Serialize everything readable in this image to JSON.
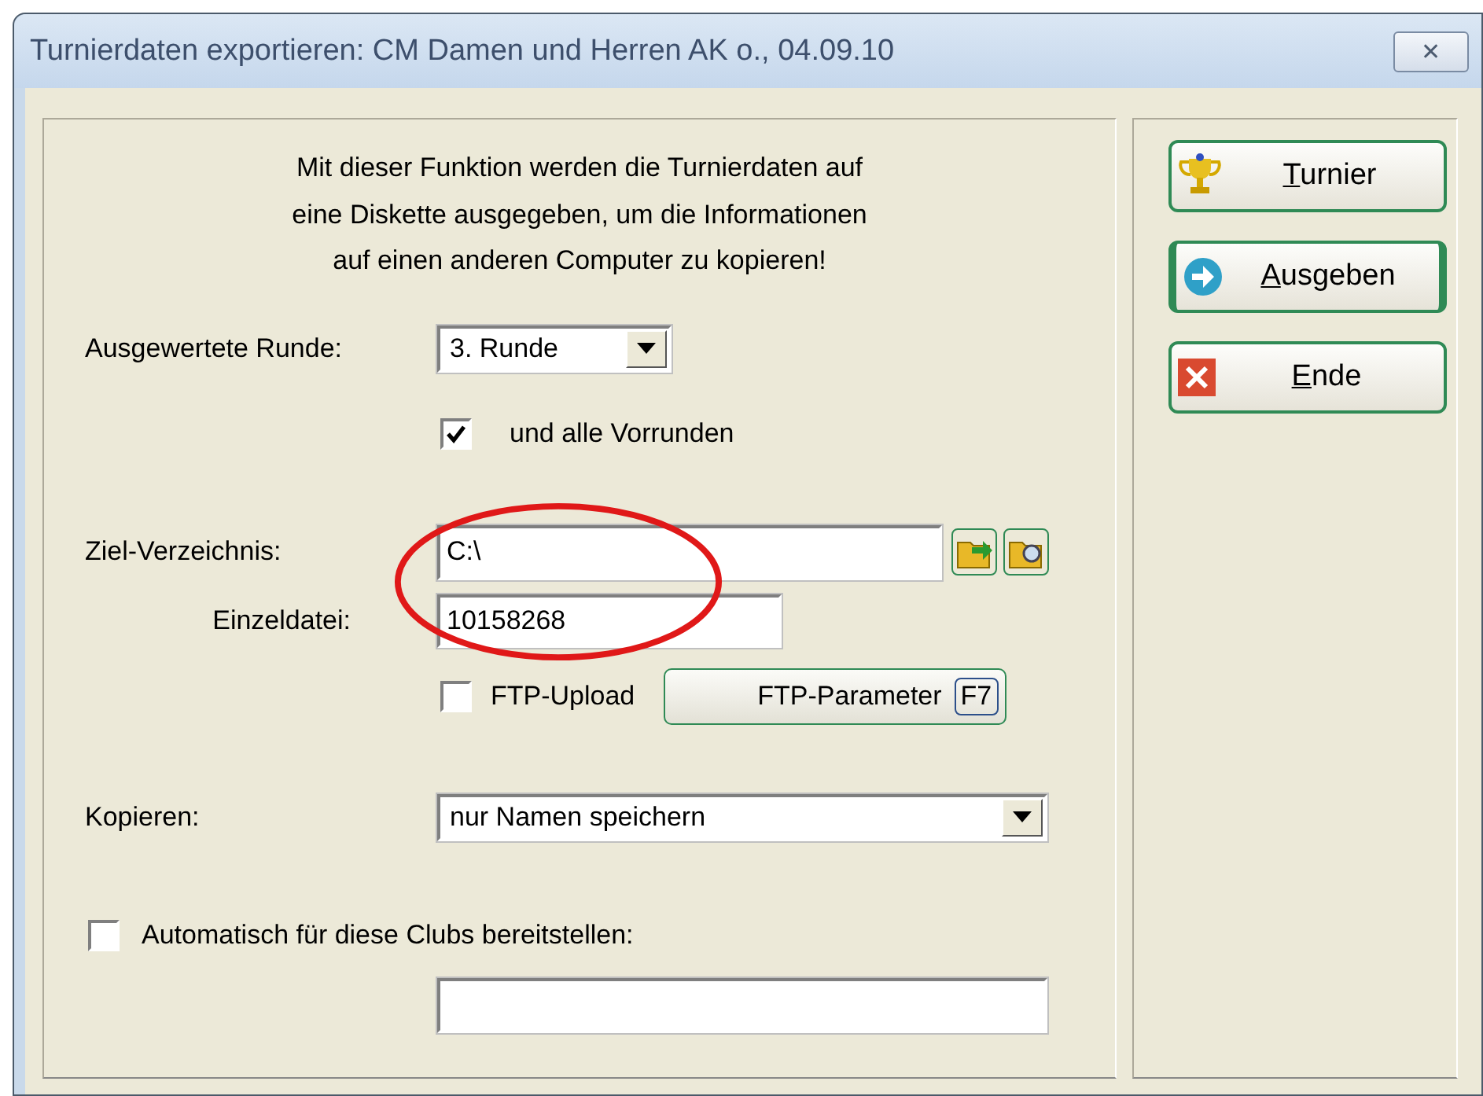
{
  "window": {
    "title": "Turnierdaten exportieren: CM Damen und Herren AK o., 04.09.10",
    "close_label": "✕"
  },
  "intro": [
    "Mit dieser Funktion werden die Turnierdaten auf",
    "eine Diskette ausgegeben, um die Informationen",
    "auf einen anderen Computer zu kopieren!"
  ],
  "round": {
    "label": "Ausgewertete Runde:",
    "value": "3. Runde"
  },
  "previous_rounds": {
    "label": "und alle Vorrunden",
    "checked": true
  },
  "target_dir": {
    "label": "Ziel-Verzeichnis:",
    "value": "C:\\"
  },
  "single_file": {
    "label": "Einzeldatei:",
    "value": "10158268"
  },
  "ftp_upload": {
    "label": "FTP-Upload",
    "checked": false
  },
  "ftp_parameter": {
    "label": "FTP-Parameter",
    "key": "F7"
  },
  "copy": {
    "label": "Kopieren:",
    "value": "nur Namen speichern"
  },
  "auto_clubs": {
    "label": "Automatisch für diese Clubs bereitstellen:",
    "checked": false
  },
  "highlight_ellipse": true,
  "buttons": [
    {
      "kind": "trophy",
      "mnemonic": "T",
      "label_rest": "urnier",
      "selected": false
    },
    {
      "kind": "arrow",
      "mnemonic": "A",
      "label_rest": "usgeben",
      "selected": true
    },
    {
      "kind": "close",
      "mnemonic": "E",
      "label_rest": "nde",
      "selected": false
    }
  ]
}
